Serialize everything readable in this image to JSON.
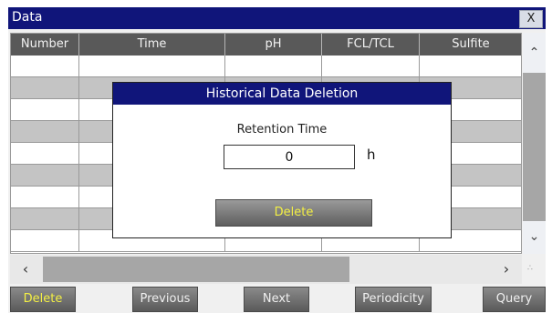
{
  "window": {
    "title": "Data",
    "close_label": "X"
  },
  "table": {
    "columns": [
      "Number",
      "Time",
      "pH",
      "FCL/TCL",
      "Sulfite"
    ]
  },
  "scroll": {
    "up_icon": "chevron-up-icon",
    "down_icon": "chevron-down-icon",
    "left_icon": "chevron-left-icon",
    "right_icon": "chevron-right-icon"
  },
  "toolbar": {
    "delete_label": "Delete",
    "previous_label": "Previous",
    "next_label": "Next",
    "periodicity_label": "Periodicity",
    "query_label": "Query"
  },
  "dialog": {
    "title": "Historical Data Deletion",
    "field_label": "Retention Time",
    "field_value": "0",
    "unit": "h",
    "delete_label": "Delete"
  },
  "colors": {
    "titlebar": "#10157a",
    "header": "#595959",
    "row_alt": "#c4c4c4",
    "highlight_text": "#f4f044"
  }
}
